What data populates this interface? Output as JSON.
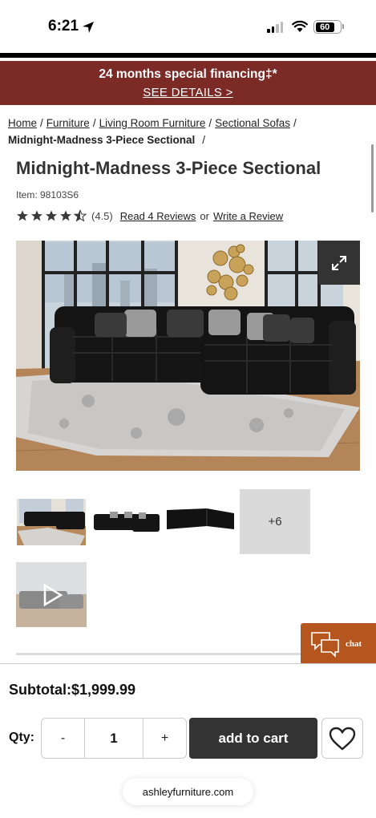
{
  "status_bar": {
    "time": "6:21",
    "battery": "60"
  },
  "promo": {
    "title": "24 months special financing‡*",
    "link": "SEE DETAILS >"
  },
  "breadcrumb": {
    "items": [
      "Home",
      "Furniture",
      "Living Room Furniture",
      "Sectional Sofas"
    ],
    "current": "Midnight-Madness 3-Piece Sectional"
  },
  "product": {
    "title": "Midnight-Madness 3-Piece Sectional",
    "item_number": "Item: 98103S6",
    "rating_value": "(4.5)",
    "rating": 4.5,
    "read_reviews": "Read 4 Reviews",
    "or_text": "or",
    "write_review": "Write a Review"
  },
  "gallery": {
    "more_label": "+6"
  },
  "chat": {
    "label": "chat"
  },
  "footer": {
    "subtotal": "Subtotal:$1,999.99",
    "qty_label": "Qty:",
    "qty_minus": "-",
    "qty_value": "1",
    "qty_plus": "+",
    "add_to_cart": "add to cart"
  },
  "browser": {
    "url": "ashleyfurniture.com"
  },
  "colors": {
    "promo_bg": "#7b2a26",
    "chat_bg": "#b5561f",
    "button_dark": "#333333"
  }
}
